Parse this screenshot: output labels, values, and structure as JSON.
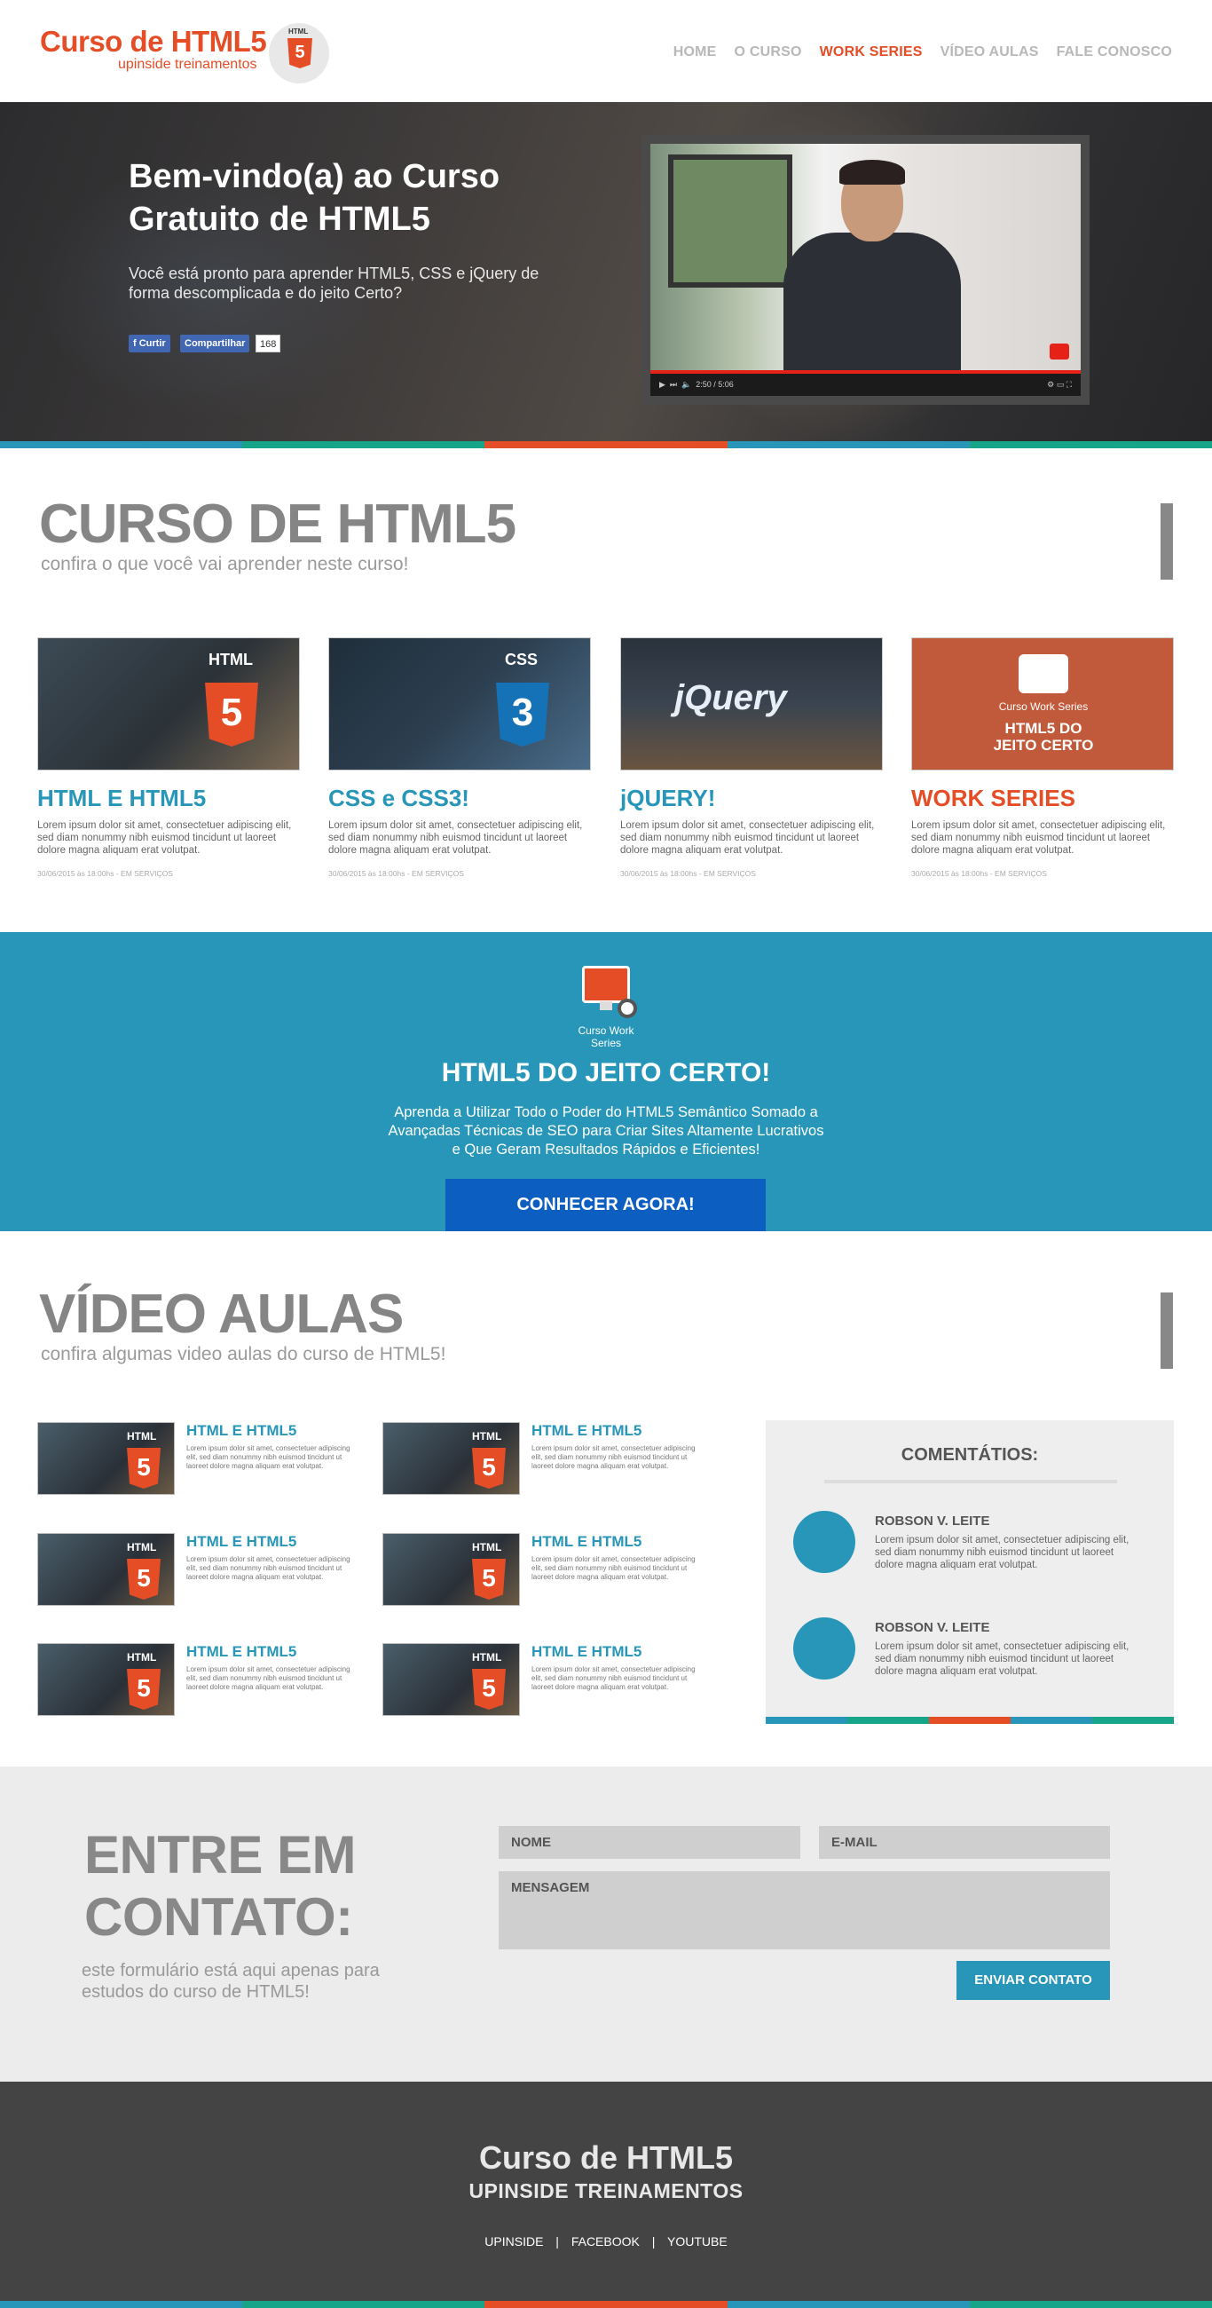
{
  "header": {
    "logo_title": "Curso de HTML5",
    "logo_subtitle": "upinside treinamentos",
    "logo_badge": "HTML",
    "nav": [
      {
        "label": "HOME"
      },
      {
        "label": "O CURSO"
      },
      {
        "label": "WORK SERIES",
        "active": true
      },
      {
        "label": "VÍDEO AULAS"
      },
      {
        "label": "FALE CONOSCO"
      }
    ]
  },
  "hero": {
    "title": "Bem-vindo(a) ao Curso Gratuito de HTML5",
    "text": "Você está pronto para aprender HTML5, CSS e jQuery de forma descomplicada e do jeito Certo?",
    "fb_like": "Curtir",
    "fb_share": "Compartilhar",
    "fb_count": "168",
    "video_time": "2:50 / 5:06"
  },
  "colors": {
    "accent_orange": "#e44d26",
    "accent_blue": "#2796b8",
    "accent_green": "#17a589",
    "button_blue": "#0c5ec0",
    "stripe": [
      "#2796b8",
      "#17a589",
      "#e44d26",
      "#2796b8",
      "#17a589"
    ]
  },
  "curso": {
    "title": "CURSO DE HTML5",
    "subtitle": "confira o que você vai aprender neste curso!",
    "cards": [
      {
        "title": "HTML E HTML5",
        "color": "#2796b8",
        "badge": "HTML",
        "text": "Lorem ipsum dolor sit amet, consectetuer adipiscing elit, sed diam nonummy nibh euismod tincidunt ut laoreet dolore magna aliquam erat volutpat.",
        "meta": "30/06/2015 às 18:00hs - EM SERVIÇOS"
      },
      {
        "title": "CSS e CSS3!",
        "color": "#2796b8",
        "badge": "CSS",
        "text": "Lorem ipsum dolor sit amet, consectetuer adipiscing elit, sed diam nonummy nibh euismod tincidunt ut laoreet dolore magna aliquam erat volutpat.",
        "meta": "30/06/2015 às 18:00hs - EM SERVIÇOS"
      },
      {
        "title": "jQUERY!",
        "color": "#2796b8",
        "badge": "jQuery",
        "text": "Lorem ipsum dolor sit amet, consectetuer adipiscing elit, sed diam nonummy nibh euismod tincidunt ut laoreet dolore magna aliquam erat volutpat.",
        "meta": "30/06/2015 às 18:00hs - EM SERVIÇOS"
      },
      {
        "title": "WORK SERIES",
        "color": "#e44d26",
        "badge": "Curso Work Series",
        "badge2": "HTML5 DO JEITO CERTO",
        "text": "Lorem ipsum dolor sit amet, consectetuer adipiscing elit, sed diam nonummy nibh euismod tincidunt ut laoreet dolore magna aliquam erat volutpat.",
        "meta": "30/06/2015 às 18:00hs - EM SERVIÇOS"
      }
    ]
  },
  "promo": {
    "icon_label": "Curso Work Series",
    "title": "HTML5 DO JEITO CERTO!",
    "text": "Aprenda a Utilizar Todo o Poder do HTML5 Semântico Somado a Avançadas Técnicas de SEO para Criar Sites Altamente Lucrativos e Que Geram Resultados Rápidos e Eficientes!",
    "button": "CONHECER AGORA!"
  },
  "aulas": {
    "title": "VÍDEO AULAS",
    "subtitle": "confira algumas video aulas do curso de HTML5!",
    "videos": [
      {
        "title": "HTML E HTML5",
        "badge": "HTML",
        "text": "Lorem ipsum dolor sit amet, consectetuer adipiscing elit, sed diam nonummy nibh euismod tincidunt ut laoreet dolore magna aliquam erat volutpat."
      },
      {
        "title": "HTML E HTML5",
        "badge": "HTML",
        "text": "Lorem ipsum dolor sit amet, consectetuer adipiscing elit, sed diam nonummy nibh euismod tincidunt ut laoreet dolore magna aliquam erat volutpat."
      },
      {
        "title": "HTML E HTML5",
        "badge": "HTML",
        "text": "Lorem ipsum dolor sit amet, consectetuer adipiscing elit, sed diam nonummy nibh euismod tincidunt ut laoreet dolore magna aliquam erat volutpat."
      },
      {
        "title": "HTML E HTML5",
        "badge": "HTML",
        "text": "Lorem ipsum dolor sit amet, consectetuer adipiscing elit, sed diam nonummy nibh euismod tincidunt ut laoreet dolore magna aliquam erat volutpat."
      },
      {
        "title": "HTML E HTML5",
        "badge": "HTML",
        "text": "Lorem ipsum dolor sit amet, consectetuer adipiscing elit, sed diam nonummy nibh euismod tincidunt ut laoreet dolore magna aliquam erat volutpat."
      },
      {
        "title": "HTML E HTML5",
        "badge": "HTML",
        "text": "Lorem ipsum dolor sit amet, consectetuer adipiscing elit, sed diam nonummy nibh euismod tincidunt ut laoreet dolore magna aliquam erat volutpat."
      }
    ]
  },
  "comments": {
    "title": "COMENTÁTIOS:",
    "items": [
      {
        "name": "ROBSON V. LEITE",
        "text": "Lorem ipsum dolor sit amet, consectetuer adipiscing elit, sed diam nonummy nibh euismod tincidunt ut laoreet dolore magna aliquam erat volutpat."
      },
      {
        "name": "ROBSON V. LEITE",
        "text": "Lorem ipsum dolor sit amet, consectetuer adipiscing elit, sed diam nonummy nibh euismod tincidunt ut laoreet dolore magna aliquam erat volutpat."
      }
    ]
  },
  "contact": {
    "title": "ENTRE EM CONTATO:",
    "subtitle": "este formulário está aqui apenas para estudos do curso de HTML5!",
    "name_placeholder": "NOME",
    "email_placeholder": "E-MAIL",
    "message_placeholder": "MENSAGEM",
    "button": "ENVIAR CONTATO"
  },
  "footer": {
    "title": "Curso de HTML5",
    "subtitle": "UPINSIDE TREINAMENTOS",
    "links": [
      "UPINSIDE",
      "FACEBOOK",
      "YOUTUBE"
    ],
    "separator": "|"
  }
}
